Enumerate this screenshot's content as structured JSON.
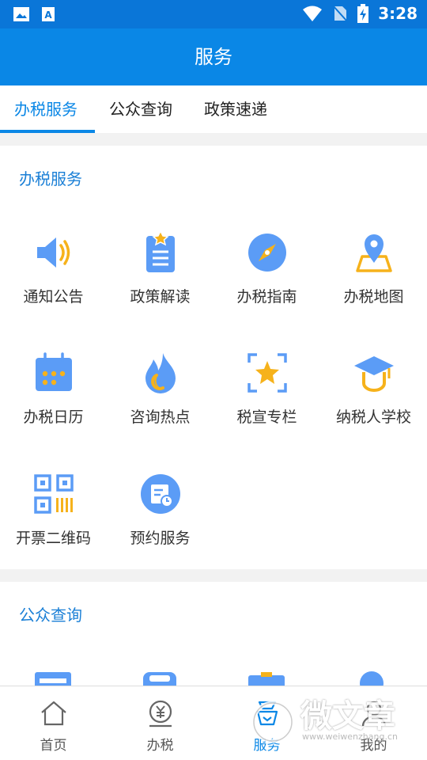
{
  "status_bar": {
    "time": "3:28",
    "icons": [
      "image-icon",
      "text-icon",
      "wifi-icon",
      "no-sim-icon",
      "battery-charging-icon"
    ]
  },
  "app_bar": {
    "title": "服务"
  },
  "tabs": [
    {
      "label": "办税服务",
      "active": true
    },
    {
      "label": "公众查询",
      "active": false
    },
    {
      "label": "政策速递",
      "active": false
    }
  ],
  "sections": [
    {
      "title": "办税服务",
      "items": [
        {
          "label": "通知公告",
          "icon": "speaker-icon"
        },
        {
          "label": "政策解读",
          "icon": "document-star-icon"
        },
        {
          "label": "办税指南",
          "icon": "compass-icon"
        },
        {
          "label": "办税地图",
          "icon": "map-pin-icon"
        },
        {
          "label": "办税日历",
          "icon": "calendar-icon"
        },
        {
          "label": "咨询热点",
          "icon": "flame-icon"
        },
        {
          "label": "税宣专栏",
          "icon": "star-frame-icon"
        },
        {
          "label": "纳税人学校",
          "icon": "graduation-cap-icon"
        },
        {
          "label": "开票二维码",
          "icon": "qrcode-icon"
        },
        {
          "label": "预约服务",
          "icon": "appointment-icon"
        }
      ]
    },
    {
      "title": "公众查询",
      "items": []
    }
  ],
  "bottom_nav": [
    {
      "label": "首页",
      "icon": "home-icon",
      "active": false
    },
    {
      "label": "办税",
      "icon": "tax-yen-icon",
      "active": false
    },
    {
      "label": "服务",
      "icon": "service-icon",
      "active": true
    },
    {
      "label": "我的",
      "icon": "user-icon",
      "active": false
    }
  ],
  "watermark": {
    "text": "微文章",
    "url": "www.weiwenzhang.cn"
  },
  "colors": {
    "primary": "#0a87e6",
    "status_bar": "#0a76d8",
    "icon_blue": "#5b9cf6",
    "icon_orange": "#f6b21b"
  }
}
